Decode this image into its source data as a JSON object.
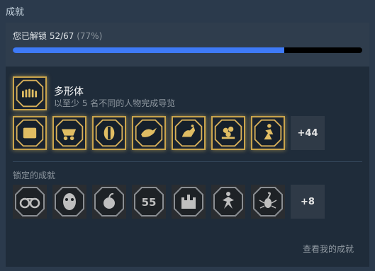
{
  "section_title": "成就",
  "progress": {
    "label": "您已解锁 52/67",
    "percent_text": "(77%)",
    "unlocked": 52,
    "total": 67,
    "fraction": 0.776
  },
  "highlight": {
    "title": "多形体",
    "description": "以至少 5 名不同的人物完成导览",
    "icon": "hands-row-icon"
  },
  "unlocked_icons": [
    "chest-icon",
    "cart-icon",
    "mask-icon",
    "bird-icon",
    "horseman-icon",
    "flower-wagon-icon",
    "runner-icon"
  ],
  "unlocked_more": "+44",
  "locked_title": "锁定的成就",
  "locked_icons": [
    "handcuffs-icon",
    "hockey-mask-icon",
    "fruit-icon",
    "number-55-icon",
    "castle-icon",
    "dancer-icon",
    "scorpion-icon"
  ],
  "locked_more": "+8",
  "view_link": "查看我的成就",
  "colors": {
    "accent": "#3e7af7",
    "gold": "#c9a44c",
    "background": "#2b3a4c"
  }
}
